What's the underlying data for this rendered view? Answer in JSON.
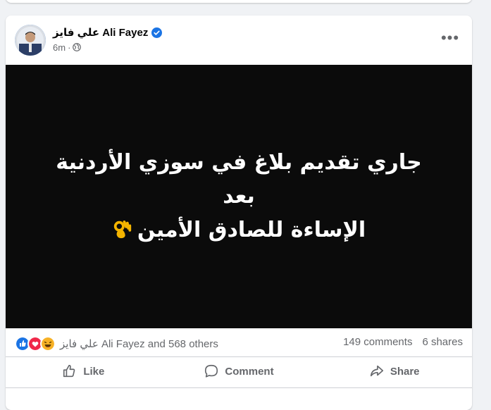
{
  "post": {
    "author": "علي فايز Ali Fayez",
    "timestamp": "6m",
    "separator": "·",
    "text_line1": "جاري تقديم بلاغ في سوزي الأردنية بعد",
    "text_line2": "الإساءة للصادق الأمين",
    "more_label": "•••"
  },
  "stats": {
    "reactions_label": "علي فايز Ali Fayez and 568 others",
    "comments": "149 comments",
    "shares": "6 shares"
  },
  "actions": {
    "like": "Like",
    "comment": "Comment",
    "share": "Share"
  },
  "icons": {
    "verified": "verified-badge-icon",
    "privacy": "globe-icon",
    "reactions": [
      "like-reaction-icon",
      "love-reaction-icon",
      "haha-reaction-icon"
    ],
    "emoji": "ok-hand-emoji"
  },
  "colors": {
    "brand_blue": "#1b74e4",
    "media_bg": "#0b0b0b",
    "secondary_text": "#65676b"
  }
}
